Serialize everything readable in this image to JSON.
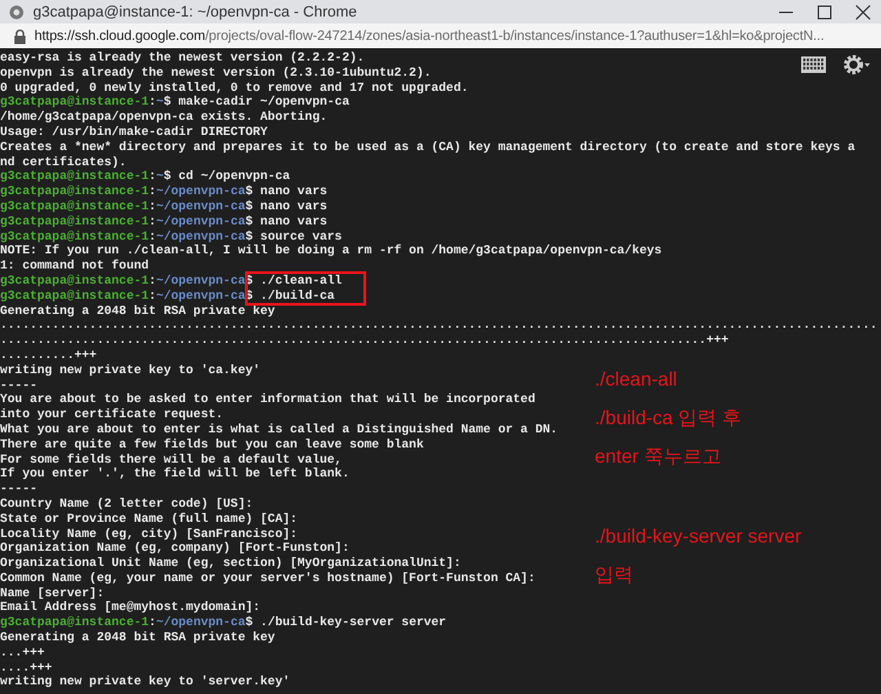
{
  "window": {
    "title": "g3catpapa@instance-1: ~/openvpn-ca - Chrome"
  },
  "address_bar": {
    "host": "https://ssh.cloud.google.com",
    "path": "/projects/oval-flow-247214/zones/asia-northeast1-b/instances/instance-1?authuser=1&hl=ko&projectN..."
  },
  "terminal": {
    "lines": [
      {
        "kind": "text",
        "text": "easy-rsa is already the newest version (2.2.2-2)."
      },
      {
        "kind": "text",
        "text": "openvpn is already the newest version (2.3.10-1ubuntu2.2)."
      },
      {
        "kind": "text",
        "text": "0 upgraded, 0 newly installed, 0 to remove and 17 not upgraded."
      },
      {
        "kind": "prompt",
        "user": "g3catpapa@instance-1",
        "sep": ":",
        "path": "~",
        "command": "$ make-cadir ~/openvpn-ca",
        "highlighted": false
      },
      {
        "kind": "text",
        "text": "/home/g3catpapa/openvpn-ca exists. Aborting."
      },
      {
        "kind": "text",
        "text": "Usage: /usr/bin/make-cadir DIRECTORY"
      },
      {
        "kind": "text",
        "text": "Creates a *new* directory and prepares it to be used as a (CA) key management directory (to create and store keys a"
      },
      {
        "kind": "text",
        "text": "nd certificates)."
      },
      {
        "kind": "prompt",
        "user": "g3catpapa@instance-1",
        "sep": ":",
        "path": "~",
        "command": "$ cd ~/openvpn-ca",
        "highlighted": false
      },
      {
        "kind": "prompt",
        "user": "g3catpapa@instance-1",
        "sep": ":",
        "path": "~/openvpn-ca",
        "command": "$ nano vars",
        "highlighted": false
      },
      {
        "kind": "prompt",
        "user": "g3catpapa@instance-1",
        "sep": ":",
        "path": "~/openvpn-ca",
        "command": "$ nano vars",
        "highlighted": false
      },
      {
        "kind": "prompt",
        "user": "g3catpapa@instance-1",
        "sep": ":",
        "path": "~/openvpn-ca",
        "command": "$ nano vars",
        "highlighted": false
      },
      {
        "kind": "prompt",
        "user": "g3catpapa@instance-1",
        "sep": ":",
        "path": "~/openvpn-ca",
        "command": "$ source vars",
        "highlighted": false
      },
      {
        "kind": "text",
        "text": "NOTE: If you run ./clean-all, I will be doing a rm -rf on /home/g3catpapa/openvpn-ca/keys"
      },
      {
        "kind": "text",
        "text": "1: command not found"
      },
      {
        "kind": "prompt",
        "user": "g3catpapa@instance-1",
        "sep": ":",
        "path": "~/openvpn-ca",
        "command": "$ ./clean-all",
        "highlighted": true
      },
      {
        "kind": "prompt",
        "user": "g3catpapa@instance-1",
        "sep": ":",
        "path": "~/openvpn-ca",
        "command": "$ ./build-ca",
        "highlighted": true
      },
      {
        "kind": "text",
        "text": "Generating a 2048 bit RSA private key"
      },
      {
        "kind": "text",
        "text": "......................................................................................................................"
      },
      {
        "kind": "text",
        "text": "...............................................................................................+++"
      },
      {
        "kind": "text",
        "text": "..........+++"
      },
      {
        "kind": "text",
        "text": "writing new private key to 'ca.key'"
      },
      {
        "kind": "text",
        "text": "-----"
      },
      {
        "kind": "text",
        "text": "You are about to be asked to enter information that will be incorporated"
      },
      {
        "kind": "text",
        "text": "into your certificate request."
      },
      {
        "kind": "text",
        "text": "What you are about to enter is what is called a Distinguished Name or a DN."
      },
      {
        "kind": "text",
        "text": "There are quite a few fields but you can leave some blank"
      },
      {
        "kind": "text",
        "text": "For some fields there will be a default value,"
      },
      {
        "kind": "text",
        "text": "If you enter '.', the field will be left blank."
      },
      {
        "kind": "text",
        "text": "-----"
      },
      {
        "kind": "text",
        "text": "Country Name (2 letter code) [US]:"
      },
      {
        "kind": "text",
        "text": "State or Province Name (full name) [CA]:"
      },
      {
        "kind": "text",
        "text": "Locality Name (eg, city) [SanFrancisco]:"
      },
      {
        "kind": "text",
        "text": "Organization Name (eg, company) [Fort-Funston]:"
      },
      {
        "kind": "text",
        "text": "Organizational Unit Name (eg, section) [MyOrganizationalUnit]:"
      },
      {
        "kind": "text",
        "text": "Common Name (eg, your name or your server's hostname) [Fort-Funston CA]:"
      },
      {
        "kind": "text",
        "text": "Name [server]:"
      },
      {
        "kind": "text",
        "text": "Email Address [me@myhost.mydomain]:"
      },
      {
        "kind": "prompt",
        "user": "g3catpapa@instance-1",
        "sep": ":",
        "path": "~/openvpn-ca",
        "command": "$ ./build-key-server server",
        "highlighted": false
      },
      {
        "kind": "text",
        "text": "Generating a 2048 bit RSA private key"
      },
      {
        "kind": "text",
        "text": "...+++"
      },
      {
        "kind": "text",
        "text": "....+++"
      },
      {
        "kind": "text",
        "text": "writing new private key to 'server.key'"
      }
    ]
  },
  "annotations": [
    {
      "lines": [
        "./clean-all",
        "./build-ca 입력 후",
        "enter 쭉누르고"
      ]
    },
    {
      "lines": [
        "./build-key-server server",
        "입력"
      ]
    }
  ]
}
